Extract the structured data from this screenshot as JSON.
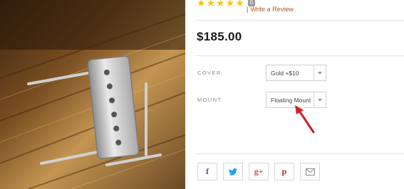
{
  "product": {
    "rating": {
      "stars": 5,
      "review_count": "0",
      "review_link": "Write a Review",
      "separator": "|"
    },
    "price": "$185.00",
    "options": [
      {
        "label": "COVER:",
        "selected": "Gold  +$10"
      },
      {
        "label": "MOUNT:",
        "selected": "Floating Mount"
      }
    ]
  },
  "share": {
    "facebook": "f",
    "twitter": "twitter-bird",
    "google_plus": "g+",
    "pinterest": "p",
    "email": "envelope"
  },
  "colors": {
    "star": "#f5c518",
    "review_link": "#b3542a",
    "facebook": "#3b5998",
    "twitter": "#1da1f2",
    "google_plus": "#dd4b39",
    "pinterest": "#cb2027",
    "arrow": "#d0202a"
  }
}
